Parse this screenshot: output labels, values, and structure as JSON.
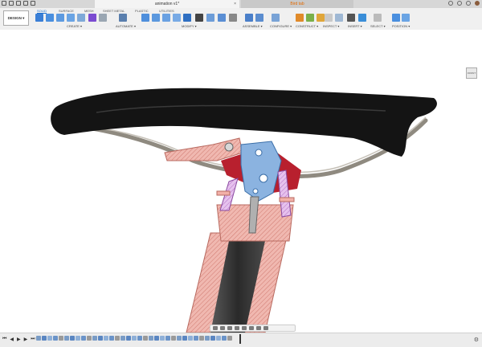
{
  "titlebar": {
    "doc_tab": "animation v1*",
    "other_tab": "Bird tab",
    "close": "×"
  },
  "ribbon": {
    "workspace": "DESIGN ▾",
    "tabs": [
      "SOLID",
      "SURFACE",
      "MESH",
      "SHEET METAL",
      "PLASTIC",
      "UTILITIES"
    ],
    "groups": [
      "CREATE ▾",
      "AUTOMATE ▾",
      "MODIFY ▾",
      "ASSEMBLE ▾",
      "CONFIGURE ▾",
      "CONSTRUCT ▾",
      "INSPECT ▾",
      "INSERT ▾",
      "SELECT ▾",
      "POSITION ▾"
    ]
  },
  "viewcube": {
    "label": "FRONT"
  },
  "colors": {
    "saddle": "#141414",
    "rail": "#8f8a80",
    "post_hatch": "#e8a9a0",
    "clamp_red": "#b8202e",
    "bolt_purple": "#c98ad6",
    "blue_part": "#8bb3e0"
  },
  "timeline": {
    "controls": [
      "⏮",
      "◀",
      "▶",
      "▶",
      "⏭"
    ],
    "settings": "⚙"
  }
}
